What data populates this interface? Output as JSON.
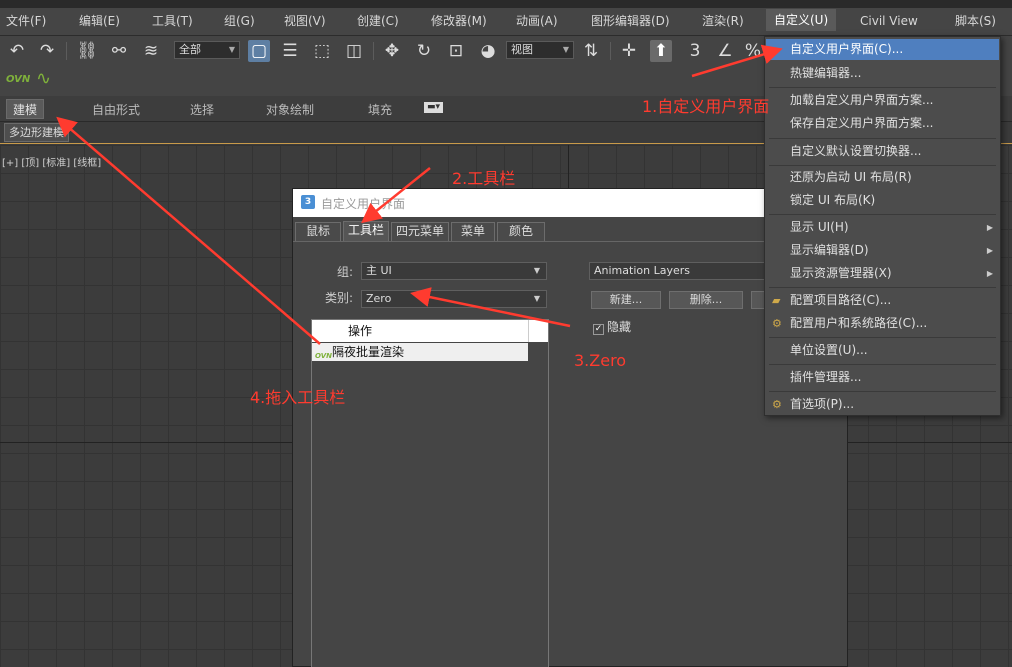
{
  "menubar": {
    "items": [
      "文件(F)",
      "编辑(E)",
      "工具(T)",
      "组(G)",
      "视图(V)",
      "创建(C)",
      "修改器(M)",
      "动画(A)",
      "图形编辑器(D)",
      "渲染(R)",
      "自定义(U)",
      "Civil View",
      "脚本(S)"
    ],
    "active_index": 10
  },
  "toolbar": {
    "selection_filter": "全部",
    "reference_coord": "视图"
  },
  "toolbar2": {
    "plugin_label": "OVN"
  },
  "ribbon": {
    "tabs": [
      "建模",
      "自由形式",
      "选择",
      "对象绘制",
      "填充"
    ],
    "subtab": "多边形建模"
  },
  "viewport": {
    "label": "[+] [顶] [标准] [线框]"
  },
  "dialog": {
    "title": "自定义用户界面",
    "tabs": [
      "鼠标",
      "工具栏",
      "四元菜单",
      "菜单",
      "颜色"
    ],
    "active_tab": 1,
    "group_label": "组:",
    "group_value": "主 UI",
    "category_label": "类别:",
    "category_value": "Zero",
    "action_header": "操作",
    "action_row": "隔夜批量渲染",
    "toolbar_select": "Animation Layers",
    "new_button": "新建...",
    "delete_button": "删除...",
    "hide_checkbox": "隐藏",
    "hide_checked": true
  },
  "dropdown": {
    "items": [
      {
        "label": "自定义用户界面(C)...",
        "highlight": true
      },
      {
        "label": "热键编辑器..."
      },
      {
        "label": "加载自定义用户界面方案..."
      },
      {
        "label": "保存自定义用户界面方案..."
      },
      {
        "label": "自定义默认设置切换器..."
      },
      {
        "label": "还原为启动 UI 布局(R)"
      },
      {
        "label": "锁定 UI 布局(K)"
      },
      {
        "label": "显示 UI(H)",
        "submenu": true
      },
      {
        "label": "显示编辑器(D)",
        "submenu": true
      },
      {
        "label": "显示资源管理器(X)",
        "submenu": true
      },
      {
        "label": "配置项目路径(C)...",
        "icon": true
      },
      {
        "label": "配置用户和系统路径(C)...",
        "icon": true
      },
      {
        "label": "单位设置(U)..."
      },
      {
        "label": "插件管理器..."
      },
      {
        "label": "首选项(P)...",
        "icon": true
      }
    ]
  },
  "annotations": {
    "step1": "1.自定义用户界面",
    "step2": "2.工具栏",
    "step3": "3.Zero",
    "step4": "4.拖入工具栏",
    "color": "#ff3b2f"
  }
}
